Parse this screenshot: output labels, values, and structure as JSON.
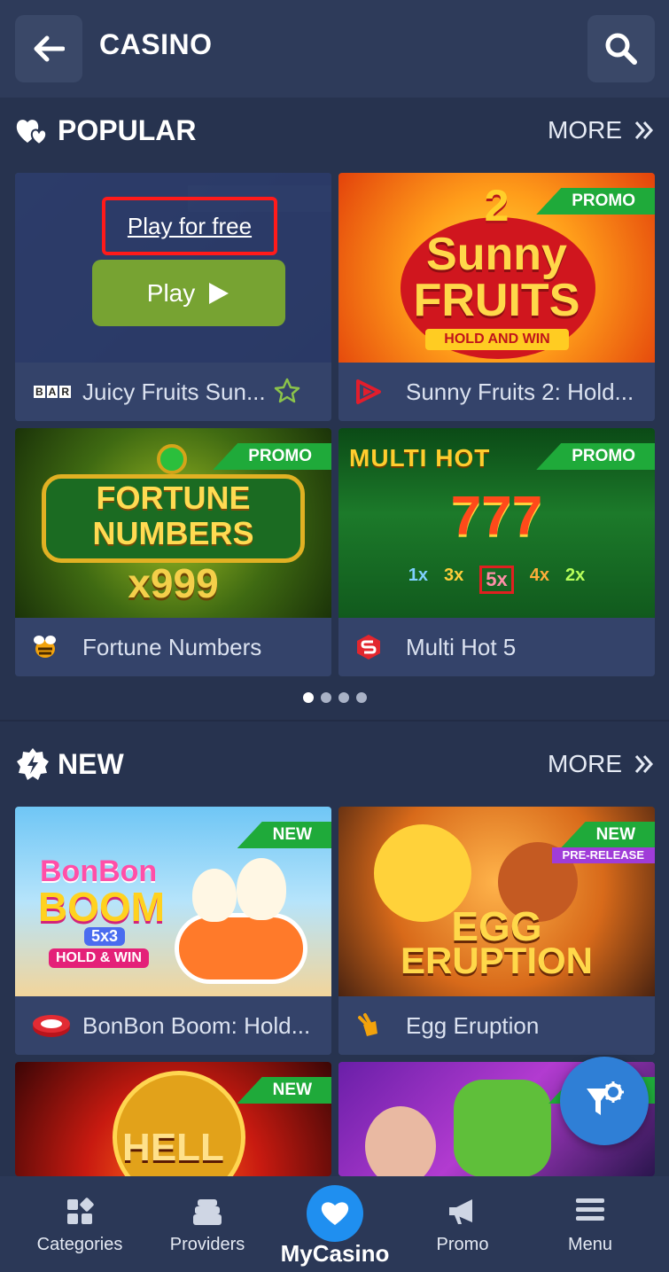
{
  "header": {
    "title": "CASINO"
  },
  "sections": {
    "popular": {
      "title": "POPULAR",
      "more": "MORE"
    },
    "new": {
      "title": "NEW",
      "more": "MORE"
    }
  },
  "popular_games": [
    {
      "name": "Juicy Fruits Sun...",
      "provider_logo": "BAR",
      "play_free": "Play for free",
      "play": "Play"
    },
    {
      "name": "Sunny Fruits 2: Hold...",
      "badge": "PROMO",
      "thumb_title": "2",
      "thumb_title2": "Sunny",
      "thumb_title3": "FRUITS",
      "thumb_sub": "HOLD AND WIN"
    },
    {
      "name": "Fortune Numbers",
      "badge": "PROMO",
      "thumb_title": "FORTUNE",
      "thumb_title2": "NUMBERS",
      "thumb_sub": "x999"
    },
    {
      "name": "Multi Hot 5",
      "badge": "PROMO",
      "thumb_title": "MULTI HOT",
      "thumb_sub": "777",
      "multipliers": [
        "1x",
        "3x",
        "5x",
        "4x",
        "2x"
      ]
    }
  ],
  "new_games": [
    {
      "name": "BonBon Boom: Hold...",
      "badge": "NEW",
      "thumb_title": "BonBon",
      "thumb_title2": "BOOM",
      "thumb_sub": "5x3",
      "thumb_sub2": "HOLD & WIN"
    },
    {
      "name": "Egg Eruption",
      "badge": "NEW",
      "badge2": "PRE-RELEASE",
      "thumb_title": "EGG",
      "thumb_title2": "ERUPTION"
    },
    {
      "name": "",
      "badge": "NEW",
      "thumb_title": "HELL"
    },
    {
      "name": "",
      "badge": ""
    }
  ],
  "pagination": {
    "count": 4,
    "active": 0
  },
  "nav": {
    "categories": "Categories",
    "providers": "Providers",
    "mycasino": "MyCasino",
    "promo": "Promo",
    "menu": "Menu"
  },
  "colors": {
    "bg": "#27334f",
    "accent_green": "#1faa3a",
    "play_green": "#77a332",
    "fab_blue": "#2f7fd6",
    "highlight_red": "#ff1a1a"
  }
}
